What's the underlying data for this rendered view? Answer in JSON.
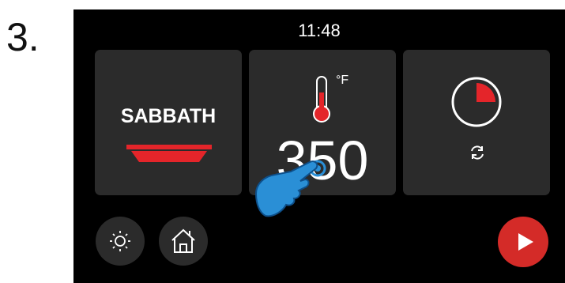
{
  "step_number": "3.",
  "status_bar": {
    "time": "11:48"
  },
  "tiles": {
    "mode": {
      "label": "SABBATH",
      "icon": "baking-pan-icon"
    },
    "temperature": {
      "value": "350",
      "unit": "°F",
      "icon": "thermometer-icon"
    },
    "timer": {
      "icon": "timer-icon",
      "secondary_icon": "refresh-icon"
    }
  },
  "bottom_bar": {
    "light_icon": "light-bulb-icon",
    "home_icon": "home-icon",
    "start_icon": "play-icon"
  },
  "colors": {
    "screen_bg": "#000000",
    "tile_bg": "#2b2b2b",
    "accent_red": "#d42b28",
    "touch_hand": "#2a8fd6"
  }
}
